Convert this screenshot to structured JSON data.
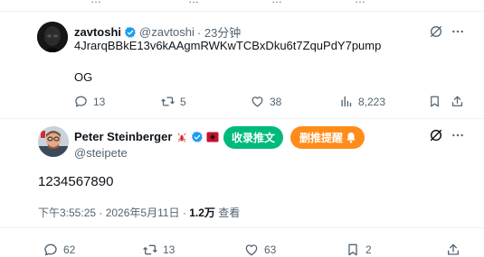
{
  "colors": {
    "verified": "#1d9bf0",
    "muted": "#536471",
    "text": "#0f1419",
    "divider": "#eff3f4",
    "collect_btn": "#00ba7c",
    "delete_btn": "#ff8c1a"
  },
  "top_actions": [
    "…",
    "…",
    "…",
    "…"
  ],
  "reply": {
    "name": "zavtoshi",
    "handle": "@zavtoshi",
    "time": "· 23分钟",
    "text_line1": "4JrarqBBkE13v6kAAgmRWKwTCBxDku6t7ZquPdY7pump",
    "text_line2": "OG",
    "actions": {
      "replies": "13",
      "reposts": "5",
      "likes": "38",
      "views": "8,223"
    }
  },
  "main": {
    "name": "Peter Steinberger",
    "handle": "@steipete",
    "collect_button": "收录推文",
    "delete_button": "删推提醒",
    "text": "1234567890",
    "timestamp": "下午3:55:25 · 2026年5月11日 · ",
    "views_value": "1.2万",
    "views_label": " 查看",
    "actions": {
      "replies": "62",
      "reposts": "13",
      "likes": "63",
      "bookmarks": "2"
    }
  }
}
